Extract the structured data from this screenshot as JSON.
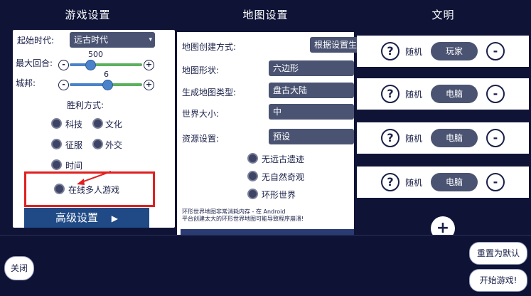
{
  "headers": {
    "game_settings": "游戏设置",
    "map_settings": "地图设置",
    "civs": "文明"
  },
  "game": {
    "start_era_label": "起始时代:",
    "start_era_value": "远古时代",
    "max_turns_label": "最大回合:",
    "max_turns_value": "500",
    "max_turns_fraction": 0.3,
    "city_states_label": "城邦:",
    "city_states_value": "6",
    "city_states_fraction": 0.3,
    "victory_label": "胜利方式:",
    "victory_types": [
      "科技",
      "文化",
      "征服",
      "外交",
      "时间"
    ],
    "online_multiplayer": "在线多人游戏",
    "advanced_settings": "高级设置",
    "advanced_arrow": "▶"
  },
  "map": {
    "creation_label": "地图创建方式:",
    "creation_value": "根据设置生",
    "shape_label": "地图形状:",
    "shape_value": "六边形",
    "type_label": "生成地图类型:",
    "type_value": "盘古大陆",
    "size_label": "世界大小:",
    "size_value": "中",
    "resource_label": "资源设置:",
    "resource_value": "预设",
    "options": [
      "无远古遗迹",
      "无自然奇观",
      "环形世界"
    ],
    "warning_line1": "环形世界地图非常消耗内存 - 在 Android",
    "warning_line2": "平台创建太大的环形世界地图可能导致程序崩溃!"
  },
  "civs": {
    "rows": [
      {
        "q": "?",
        "civ": "随机",
        "player": "玩家",
        "remove": "-"
      },
      {
        "q": "?",
        "civ": "随机",
        "player": "电脑",
        "remove": "-"
      },
      {
        "q": "?",
        "civ": "随机",
        "player": "电脑",
        "remove": "-"
      },
      {
        "q": "?",
        "civ": "随机",
        "player": "电脑",
        "remove": "-"
      }
    ],
    "add": "+"
  },
  "bottom": {
    "close": "关闭",
    "reset": "重置为默认",
    "start": "开始游戏!"
  },
  "colors": {
    "background": "#0e1336",
    "highlight": "#e02020",
    "dropdown": "#4a5372",
    "advanced": "#1f4a86"
  }
}
